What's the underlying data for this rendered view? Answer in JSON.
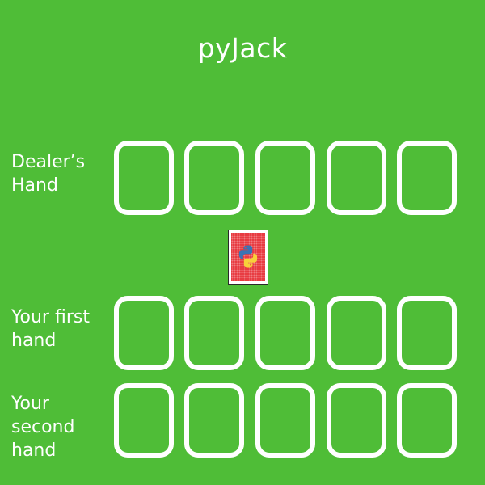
{
  "title": "pyJack",
  "hands": {
    "dealer": {
      "label": "Dealer’s\nHand",
      "slot_count": 5
    },
    "first": {
      "label": "Your first\nhand",
      "slot_count": 5
    },
    "second": {
      "label": "Your\nsecond\nhand",
      "slot_count": 5
    }
  },
  "deck": {
    "icon": "python-logo-icon",
    "back_color": "#e7363c"
  },
  "colors": {
    "table": "#4fbd37",
    "slot_outline": "#ffffff",
    "text": "#ffffff"
  }
}
